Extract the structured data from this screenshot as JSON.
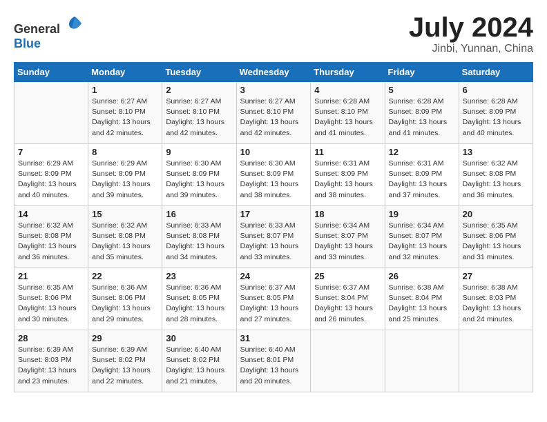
{
  "header": {
    "logo_general": "General",
    "logo_blue": "Blue",
    "month": "July 2024",
    "location": "Jinbi, Yunnan, China"
  },
  "days_of_week": [
    "Sunday",
    "Monday",
    "Tuesday",
    "Wednesday",
    "Thursday",
    "Friday",
    "Saturday"
  ],
  "weeks": [
    [
      {
        "day": "",
        "info": ""
      },
      {
        "day": "1",
        "info": "Sunrise: 6:27 AM\nSunset: 8:10 PM\nDaylight: 13 hours\nand 42 minutes."
      },
      {
        "day": "2",
        "info": "Sunrise: 6:27 AM\nSunset: 8:10 PM\nDaylight: 13 hours\nand 42 minutes."
      },
      {
        "day": "3",
        "info": "Sunrise: 6:27 AM\nSunset: 8:10 PM\nDaylight: 13 hours\nand 42 minutes."
      },
      {
        "day": "4",
        "info": "Sunrise: 6:28 AM\nSunset: 8:10 PM\nDaylight: 13 hours\nand 41 minutes."
      },
      {
        "day": "5",
        "info": "Sunrise: 6:28 AM\nSunset: 8:09 PM\nDaylight: 13 hours\nand 41 minutes."
      },
      {
        "day": "6",
        "info": "Sunrise: 6:28 AM\nSunset: 8:09 PM\nDaylight: 13 hours\nand 40 minutes."
      }
    ],
    [
      {
        "day": "7",
        "info": "Sunrise: 6:29 AM\nSunset: 8:09 PM\nDaylight: 13 hours\nand 40 minutes."
      },
      {
        "day": "8",
        "info": "Sunrise: 6:29 AM\nSunset: 8:09 PM\nDaylight: 13 hours\nand 39 minutes."
      },
      {
        "day": "9",
        "info": "Sunrise: 6:30 AM\nSunset: 8:09 PM\nDaylight: 13 hours\nand 39 minutes."
      },
      {
        "day": "10",
        "info": "Sunrise: 6:30 AM\nSunset: 8:09 PM\nDaylight: 13 hours\nand 38 minutes."
      },
      {
        "day": "11",
        "info": "Sunrise: 6:31 AM\nSunset: 8:09 PM\nDaylight: 13 hours\nand 38 minutes."
      },
      {
        "day": "12",
        "info": "Sunrise: 6:31 AM\nSunset: 8:09 PM\nDaylight: 13 hours\nand 37 minutes."
      },
      {
        "day": "13",
        "info": "Sunrise: 6:32 AM\nSunset: 8:08 PM\nDaylight: 13 hours\nand 36 minutes."
      }
    ],
    [
      {
        "day": "14",
        "info": "Sunrise: 6:32 AM\nSunset: 8:08 PM\nDaylight: 13 hours\nand 36 minutes."
      },
      {
        "day": "15",
        "info": "Sunrise: 6:32 AM\nSunset: 8:08 PM\nDaylight: 13 hours\nand 35 minutes."
      },
      {
        "day": "16",
        "info": "Sunrise: 6:33 AM\nSunset: 8:08 PM\nDaylight: 13 hours\nand 34 minutes."
      },
      {
        "day": "17",
        "info": "Sunrise: 6:33 AM\nSunset: 8:07 PM\nDaylight: 13 hours\nand 33 minutes."
      },
      {
        "day": "18",
        "info": "Sunrise: 6:34 AM\nSunset: 8:07 PM\nDaylight: 13 hours\nand 33 minutes."
      },
      {
        "day": "19",
        "info": "Sunrise: 6:34 AM\nSunset: 8:07 PM\nDaylight: 13 hours\nand 32 minutes."
      },
      {
        "day": "20",
        "info": "Sunrise: 6:35 AM\nSunset: 8:06 PM\nDaylight: 13 hours\nand 31 minutes."
      }
    ],
    [
      {
        "day": "21",
        "info": "Sunrise: 6:35 AM\nSunset: 8:06 PM\nDaylight: 13 hours\nand 30 minutes."
      },
      {
        "day": "22",
        "info": "Sunrise: 6:36 AM\nSunset: 8:06 PM\nDaylight: 13 hours\nand 29 minutes."
      },
      {
        "day": "23",
        "info": "Sunrise: 6:36 AM\nSunset: 8:05 PM\nDaylight: 13 hours\nand 28 minutes."
      },
      {
        "day": "24",
        "info": "Sunrise: 6:37 AM\nSunset: 8:05 PM\nDaylight: 13 hours\nand 27 minutes."
      },
      {
        "day": "25",
        "info": "Sunrise: 6:37 AM\nSunset: 8:04 PM\nDaylight: 13 hours\nand 26 minutes."
      },
      {
        "day": "26",
        "info": "Sunrise: 6:38 AM\nSunset: 8:04 PM\nDaylight: 13 hours\nand 25 minutes."
      },
      {
        "day": "27",
        "info": "Sunrise: 6:38 AM\nSunset: 8:03 PM\nDaylight: 13 hours\nand 24 minutes."
      }
    ],
    [
      {
        "day": "28",
        "info": "Sunrise: 6:39 AM\nSunset: 8:03 PM\nDaylight: 13 hours\nand 23 minutes."
      },
      {
        "day": "29",
        "info": "Sunrise: 6:39 AM\nSunset: 8:02 PM\nDaylight: 13 hours\nand 22 minutes."
      },
      {
        "day": "30",
        "info": "Sunrise: 6:40 AM\nSunset: 8:02 PM\nDaylight: 13 hours\nand 21 minutes."
      },
      {
        "day": "31",
        "info": "Sunrise: 6:40 AM\nSunset: 8:01 PM\nDaylight: 13 hours\nand 20 minutes."
      },
      {
        "day": "",
        "info": ""
      },
      {
        "day": "",
        "info": ""
      },
      {
        "day": "",
        "info": ""
      }
    ]
  ]
}
